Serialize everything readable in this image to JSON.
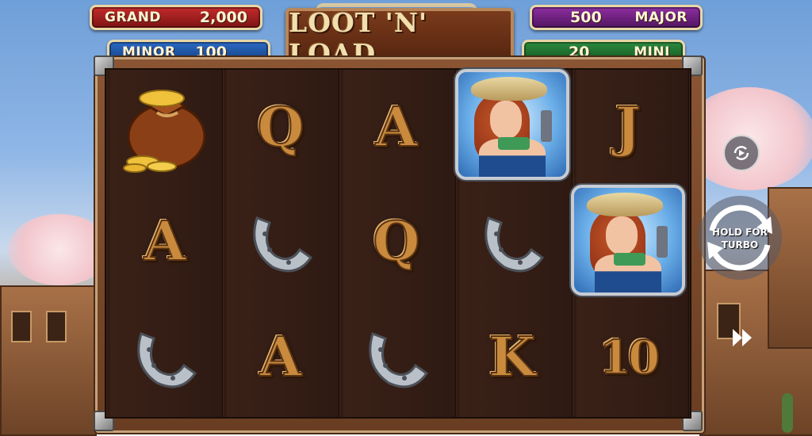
{
  "game": {
    "title": "LOOT 'N' LOAD"
  },
  "jackpots": {
    "grand": {
      "name": "GRAND",
      "value": "2,000",
      "color": "#9c1f1f"
    },
    "major": {
      "name": "MAJOR",
      "value": "500",
      "color": "#6e1f7a"
    },
    "minor": {
      "name": "MINOR",
      "value": "100",
      "color": "#1f4f9c"
    },
    "mini": {
      "name": "MINI",
      "value": "20",
      "color": "#1f6b2e"
    }
  },
  "reels": {
    "rows": [
      [
        "money-bag",
        "Q",
        "A",
        "cowgirl",
        "J"
      ],
      [
        "A",
        "horseshoe",
        "Q",
        "horseshoe",
        "cowgirl"
      ],
      [
        "horseshoe",
        "A",
        "horseshoe",
        "K",
        "10"
      ]
    ]
  },
  "controls": {
    "autoplay_icon": "autoplay-icon",
    "spin_label_line1": "HOLD FOR",
    "spin_label_line2": "TURBO",
    "fast_forward_icon": "fast-forward-icon"
  },
  "colors": {
    "card_gold": "#c98a3d",
    "board_wood": "#3b2218",
    "frame_wood": "#8a5533"
  }
}
